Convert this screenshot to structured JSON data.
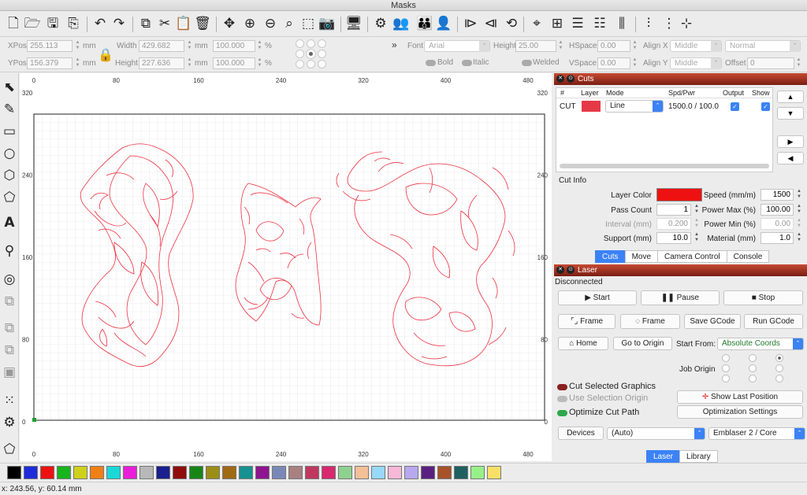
{
  "window": {
    "title": "Masks"
  },
  "toolbar": {
    "icons": [
      "new-file-icon",
      "open-folder-icon",
      "save-icon",
      "export-icon",
      "undo-icon",
      "redo-icon",
      "copy-icon",
      "cut-icon",
      "paste-icon",
      "delete-icon",
      "move-icon",
      "zoom-in-icon",
      "zoom-out-icon",
      "zoom-fit-icon",
      "selection-rect-icon",
      "camera-icon",
      "monitor-icon",
      "settings-icon",
      "users-icon",
      "user-icon",
      "mirror-horizontal-icon",
      "mirror-vertical-icon",
      "rotate-icon",
      "target-icon",
      "align-center-icon",
      "distribute-vertical-icon",
      "distribute-horizontal-icon",
      "align-h-icon",
      "align-v-icon"
    ]
  },
  "props": {
    "xpos_label": "XPos",
    "xpos": "255.113",
    "ypos_label": "YPos",
    "ypos": "156.379",
    "unit": "mm",
    "width_label": "Width",
    "width": "429.682",
    "height_label": "Height",
    "height": "227.636",
    "scale_x": "100.000",
    "scale_y": "100.000",
    "percent": "%",
    "more": "»",
    "font_label": "Font",
    "font_value": "Arial",
    "font_height_label": "Height",
    "font_height": "25.00",
    "hspace_label": "HSpace",
    "hspace": "0.00",
    "vspace_label": "VSpace",
    "vspace": "0.00",
    "alignx_label": "Align X",
    "alignx": "Middle",
    "aligny_label": "Align Y",
    "aligny": "Middle",
    "style_value": "Normal",
    "offset_label": "Offset",
    "offset": "0",
    "bold_label": "Bold",
    "italic_label": "Italic",
    "welded_label": "Welded"
  },
  "lefttools": [
    "select-arrow-icon",
    "pen-icon",
    "rectangle-icon",
    "ellipse-icon",
    "polygon-icon",
    "polyline-icon",
    "text-icon",
    "position-marker-icon",
    "offset-icon",
    "boolean-union-icon",
    "boolean-subtract-icon",
    "boolean-intersect-icon",
    "weld-icon",
    "grid-array-icon",
    "circular-array-icon",
    "trace-icon"
  ],
  "canvas": {
    "x_ticks": [
      "0",
      "80",
      "160",
      "240",
      "320",
      "400",
      "480"
    ],
    "y_ticks": [
      "320",
      "240",
      "160",
      "80",
      "0"
    ]
  },
  "cuts": {
    "title": "Cuts",
    "headers": [
      "#",
      "Layer",
      "Mode",
      "Spd/Pwr",
      "Output",
      "Show"
    ],
    "row": {
      "id": "CUT",
      "layer_color": "#e63946",
      "mode": "Line",
      "spdpwr": "1500.0 / 100.0"
    },
    "move_up": "▲",
    "move_down": "▼",
    "move_right": "▶",
    "move_left": "◀"
  },
  "cutinfo": {
    "title": "Cut Info",
    "layer_color_label": "Layer Color",
    "layer_color": "#ee1111",
    "speed_label": "Speed (mm/m)",
    "speed": "1500",
    "pass_count_label": "Pass Count",
    "pass_count": "1",
    "power_max_label": "Power Max (%)",
    "power_max": "100.00",
    "interval_label": "Interval (mm)",
    "interval": "0.200",
    "power_min_label": "Power Min (%)",
    "power_min": "0.00",
    "support_label": "Support (mm)",
    "support": "10.0",
    "material_label": "Material (mm)",
    "material": "1.0"
  },
  "tabs1": [
    "Cuts",
    "Move",
    "Camera Control",
    "Console"
  ],
  "laser": {
    "title": "Laser",
    "status": "Disconnected",
    "start": "Start",
    "pause": "Pause",
    "stop": "Stop",
    "frame1": "Frame",
    "frame2": "Frame",
    "save_gcode": "Save GCode",
    "run_gcode": "Run GCode",
    "home": "Home",
    "go_origin": "Go to Origin",
    "start_from_label": "Start From:",
    "start_from": "Absolute Coords",
    "job_origin_label": "Job Origin",
    "cut_selected": "Cut Selected Graphics",
    "use_sel_origin": "Use Selection Origin",
    "optimize": "Optimize Cut Path",
    "show_last": "Show Last Position",
    "opt_settings": "Optimization Settings",
    "devices": "Devices",
    "device_sel": "(Auto)",
    "device_type": "Emblaser 2 / Core"
  },
  "tabs2": [
    "Laser",
    "Library"
  ],
  "palette": [
    "#000000",
    "#1f2bdb",
    "#ee1111",
    "#18b41e",
    "#cfd01c",
    "#f07f15",
    "#1ad8d8",
    "#e91ed8",
    "#b8b8b8",
    "#1a1f8f",
    "#8f0d0d",
    "#178617",
    "#9b8e16",
    "#a06a14",
    "#17918f",
    "#8f1590",
    "#7a88b8",
    "#a88080",
    "#c03860",
    "#d8286e",
    "#8fd08f",
    "#f4c098",
    "#98d8f8",
    "#f8b8d8",
    "#b8a8f0",
    "#5a2080",
    "#a8522a",
    "#1e6060",
    "#98f088",
    "#f8e068"
  ],
  "status": {
    "coords": "x: 243.56, y: 60.14 mm"
  }
}
